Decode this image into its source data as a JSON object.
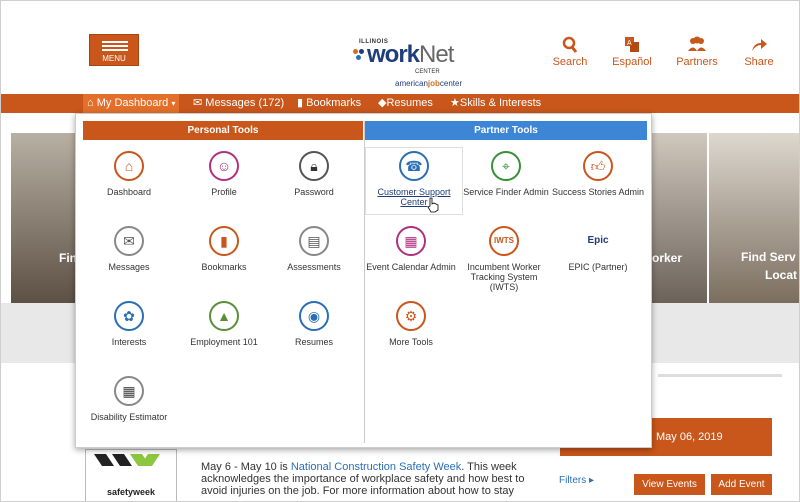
{
  "header": {
    "menu_label": "MENU",
    "logo": {
      "state": "ILLINOIS",
      "work": "work",
      "net": "Net",
      "center": "CENTER",
      "ajc_a": "american",
      "ajc_b": "job",
      "ajc_c": "center"
    },
    "toolbar": [
      {
        "label": "Search",
        "icon": "search-icon"
      },
      {
        "label": "Español",
        "icon": "translate-icon"
      },
      {
        "label": "Partners",
        "icon": "partners-icon"
      },
      {
        "label": "Share",
        "icon": "share-icon"
      }
    ]
  },
  "nav": {
    "dashboard": "My Dashboard",
    "messages": "Messages (172)",
    "bookmarks": "Bookmarks",
    "resumes": "Resumes",
    "skills": "Skills & Interests"
  },
  "dropdown": {
    "personal_title": "Personal Tools",
    "partner_title": "Partner Tools",
    "personal": [
      {
        "label": "Dashboard",
        "icon": "home-icon"
      },
      {
        "label": "Profile",
        "icon": "profile-icon"
      },
      {
        "label": "Password",
        "icon": "lock-icon"
      },
      {
        "label": "Messages",
        "icon": "envelope-icon"
      },
      {
        "label": "Bookmarks",
        "icon": "bookmark-icon"
      },
      {
        "label": "Assessments",
        "icon": "assessment-icon"
      },
      {
        "label": "Interests",
        "icon": "interests-icon"
      },
      {
        "label": "Employment 101",
        "icon": "road-icon"
      },
      {
        "label": "Resumes",
        "icon": "resume-icon"
      },
      {
        "label": "Disability Estimator",
        "icon": "calculator-icon"
      }
    ],
    "partner": [
      {
        "label": "Customer Support Center",
        "icon": "support-icon"
      },
      {
        "label": "Service Finder Admin",
        "icon": "service-finder-icon"
      },
      {
        "label": "Success Stories Admin",
        "icon": "thumbs-up-icon"
      },
      {
        "label": "Event Calendar Admin",
        "icon": "calendar-icon"
      },
      {
        "label": "Incumbent Worker Tracking System (IWTS)",
        "icon": "iwts-icon"
      },
      {
        "label": "EPIC (Partner)",
        "icon": "epic-icon"
      },
      {
        "label": "More Tools",
        "icon": "more-tools-icon"
      }
    ]
  },
  "background": {
    "banner_left": "Fin",
    "banner_mid": "orker",
    "banner_right_1": "Find Serv",
    "banner_right_2": "Locat",
    "date": "May 06, 2019",
    "filters": "Filters ▸",
    "view_events": "View Events",
    "add_event": "Add Event",
    "safety_logo": "safetyweek",
    "article_pre": "May 6 - May 10 is ",
    "article_link": "National Construction Safety Week",
    "article_post": ". This week acknowledges the importance of workplace safety and how best to avoid injuries on the job. For more information about how to stay"
  },
  "colors": {
    "brand": "#c9561b",
    "partner_header": "#3d86d6",
    "link": "#2b6fb6"
  }
}
